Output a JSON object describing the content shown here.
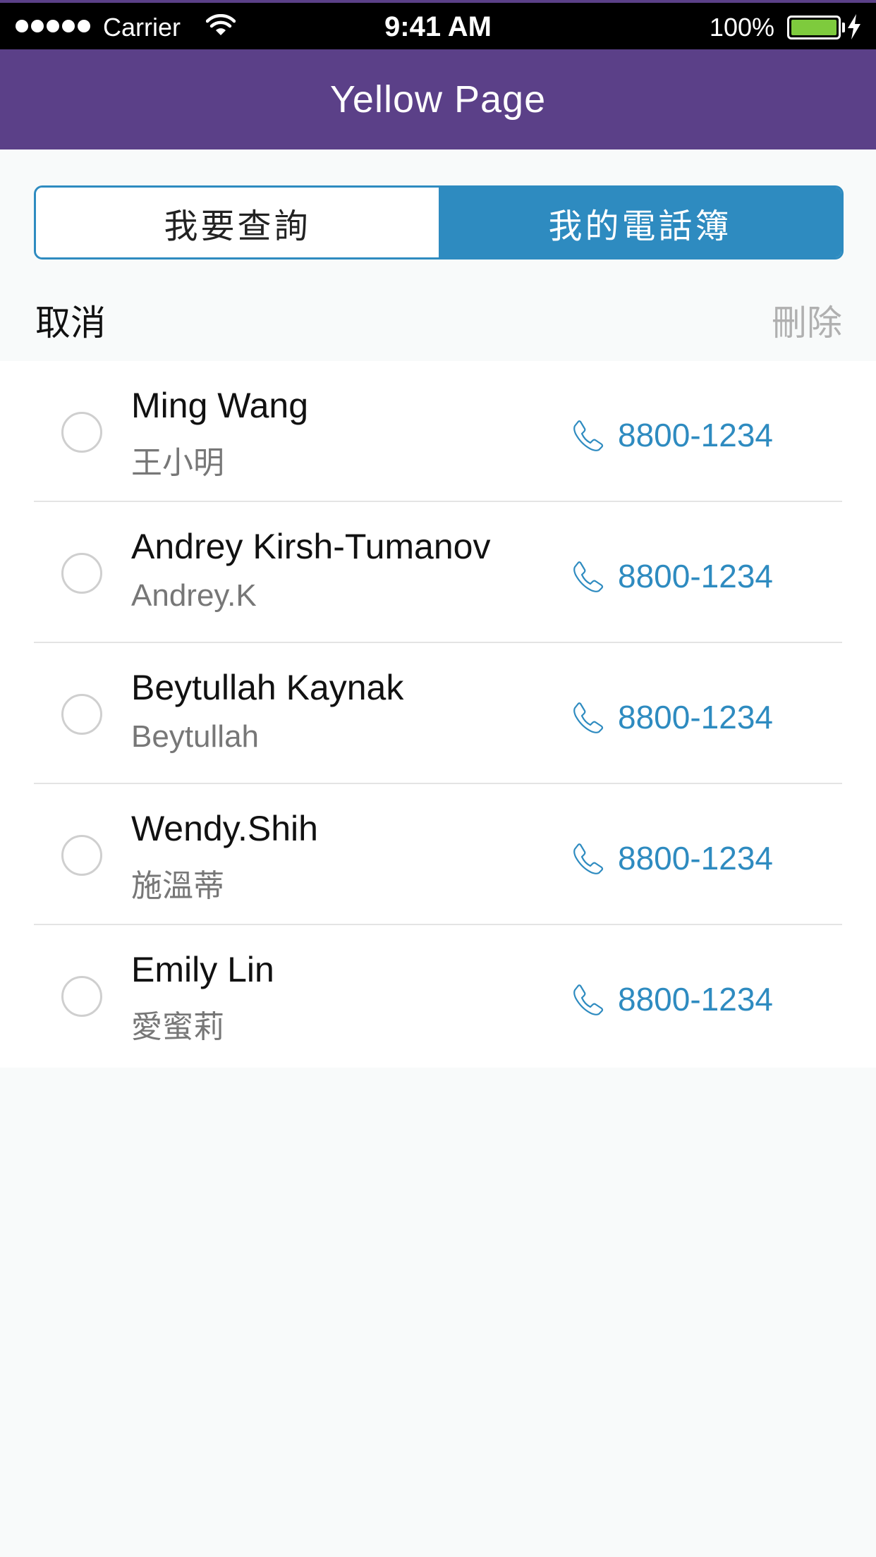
{
  "status_bar": {
    "carrier": "Carrier",
    "time": "9:41 AM",
    "battery_percent": "100%",
    "battery_level": 1.0
  },
  "nav": {
    "title": "Yellow Page"
  },
  "segment": {
    "tabs": [
      {
        "label": "我要查詢",
        "selected": false
      },
      {
        "label": "我的電話簿",
        "selected": true
      }
    ]
  },
  "actions": {
    "cancel": "取消",
    "delete": "刪除"
  },
  "contacts": [
    {
      "name": "Ming Wang",
      "subtitle": "王小明",
      "phone": "8800-1234"
    },
    {
      "name": "Andrey Kirsh-Tumanov",
      "subtitle": "Andrey.K",
      "phone": "8800-1234"
    },
    {
      "name": "Beytullah Kaynak",
      "subtitle": "Beytullah",
      "phone": "8800-1234"
    },
    {
      "name": "Wendy.Shih",
      "subtitle": "施溫蒂",
      "phone": "8800-1234"
    },
    {
      "name": "Emily Lin",
      "subtitle": "愛蜜莉",
      "phone": "8800-1234"
    }
  ],
  "colors": {
    "nav_bar": "#5b4088",
    "accent": "#2e8bc0",
    "battery": "#7ecb3d"
  },
  "icons": {
    "signal": "signal-dots-icon",
    "wifi": "wifi-icon",
    "battery": "battery-icon",
    "charging": "charging-bolt-icon",
    "phone": "phone-icon",
    "radio": "radio-unchecked-icon"
  }
}
